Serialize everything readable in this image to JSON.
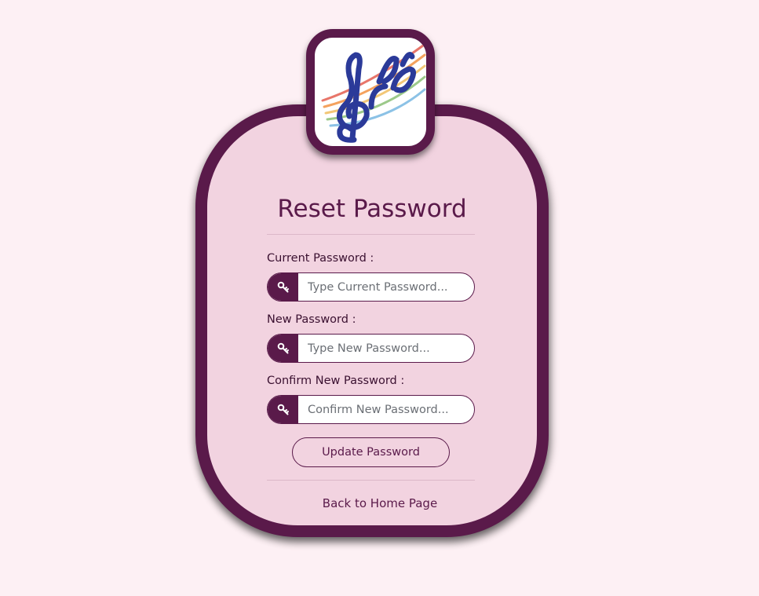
{
  "form": {
    "title": "Reset Password",
    "fields": [
      {
        "label": "Current Password :",
        "placeholder": "Type Current Password...",
        "icon": "key-icon"
      },
      {
        "label": "New Password :",
        "placeholder": "Type New Password...",
        "icon": "key-icon"
      },
      {
        "label": "Confirm New Password :",
        "placeholder": "Confirm New Password...",
        "icon": "key-icon"
      }
    ],
    "submit_label": "Update Password",
    "home_link_label": "Back to Home Page"
  },
  "logo": {
    "icon": "music-notes-logo"
  },
  "colors": {
    "page_background": "#fdf0f4",
    "card_background": "#f2d3e0",
    "accent": "#5a1a4a"
  }
}
